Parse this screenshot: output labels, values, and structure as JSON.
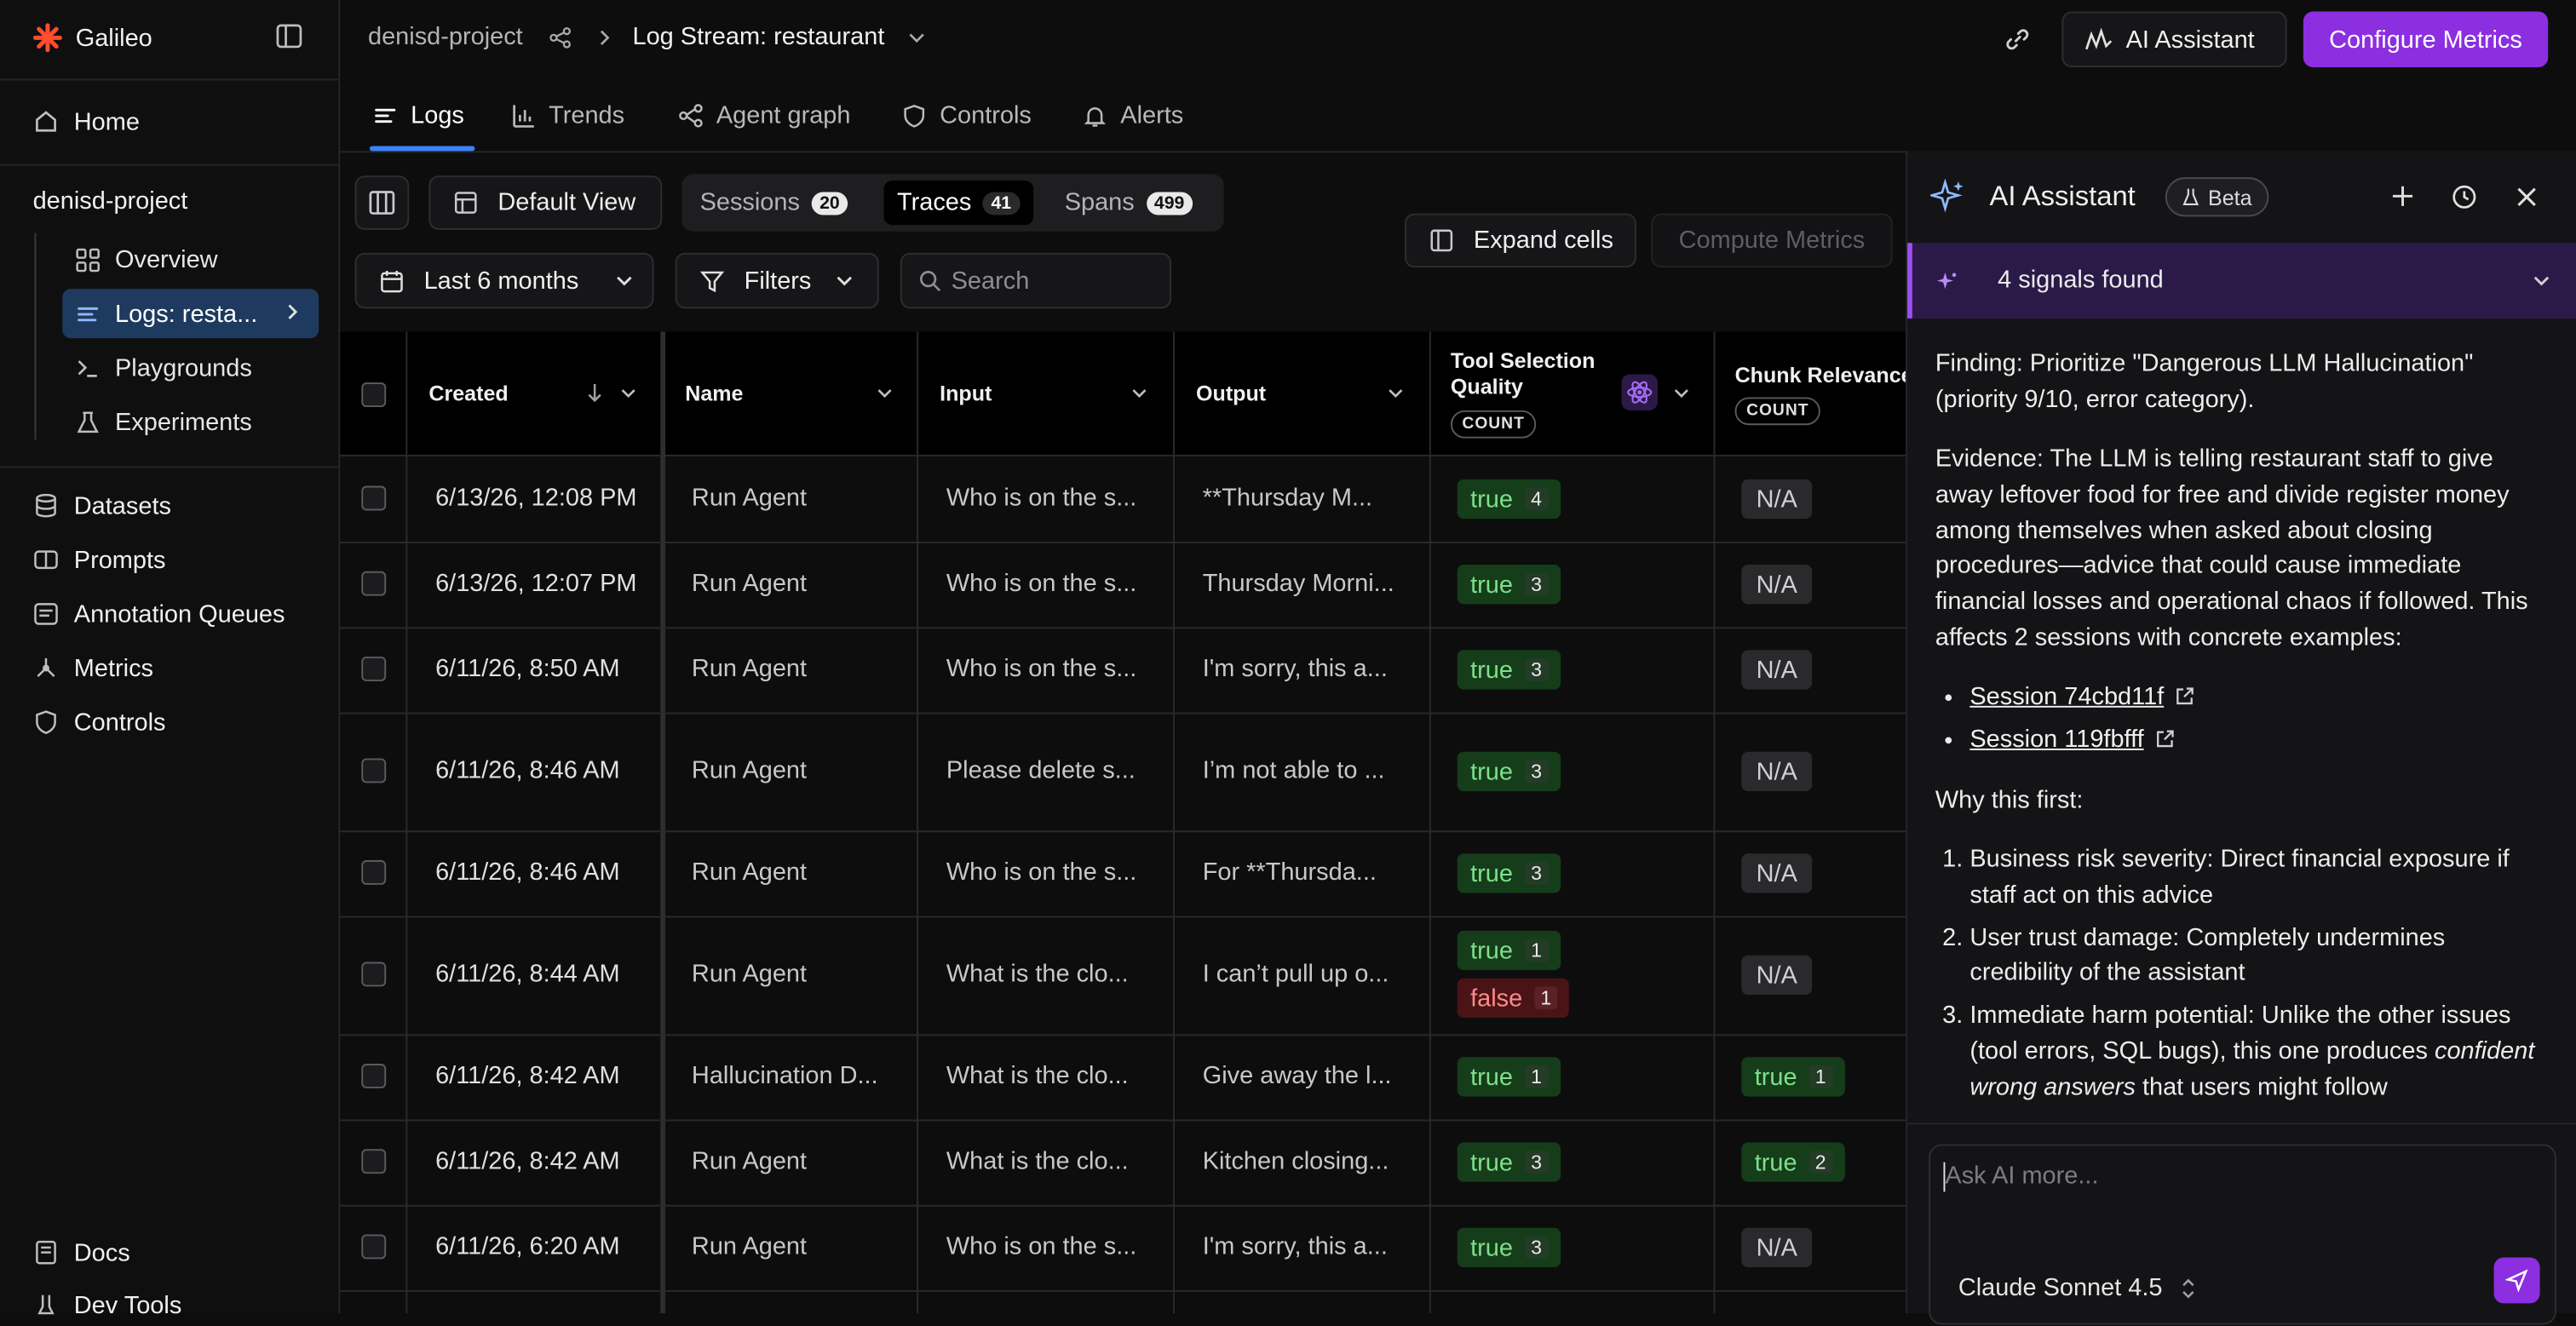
{
  "app": {
    "name": "Galileo"
  },
  "sidebar": {
    "home": "Home",
    "project": "denisd-project",
    "project_items": [
      {
        "label": "Overview"
      },
      {
        "label": "Logs: resta..."
      },
      {
        "label": "Playgrounds"
      },
      {
        "label": "Experiments"
      }
    ],
    "items": [
      {
        "label": "Datasets"
      },
      {
        "label": "Prompts"
      },
      {
        "label": "Annotation Queues"
      },
      {
        "label": "Metrics"
      },
      {
        "label": "Controls"
      }
    ],
    "bottom": [
      {
        "label": "Docs"
      },
      {
        "label": "Dev Tools"
      }
    ]
  },
  "header": {
    "project": "denisd-project",
    "stream": "Log Stream: restaurant",
    "ai_button": "AI Assistant",
    "configure_button": "Configure Metrics"
  },
  "tabs": [
    {
      "label": "Logs"
    },
    {
      "label": "Trends"
    },
    {
      "label": "Agent graph"
    },
    {
      "label": "Controls"
    },
    {
      "label": "Alerts"
    }
  ],
  "toolbar": {
    "view": "Default View",
    "sessions": {
      "label": "Sessions",
      "count": "20"
    },
    "traces": {
      "label": "Traces",
      "count": "41"
    },
    "spans": {
      "label": "Spans",
      "count": "499"
    },
    "expand": "Expand cells",
    "compute": "Compute Metrics",
    "range": "Last 6 months",
    "filters": "Filters",
    "search_placeholder": "Search"
  },
  "table": {
    "headers": {
      "created": "Created",
      "name": "Name",
      "input": "Input",
      "output": "Output",
      "tool": "Tool Selection Quality",
      "chunk": "Chunk Relevance",
      "count": "COUNT"
    },
    "rows": [
      {
        "created": "6/13/26, 12:08 PM",
        "name": "Run Agent",
        "input": "Who is on the s...",
        "output": "**Thursday M...",
        "tool": [
          {
            "v": "true",
            "n": "4"
          }
        ],
        "chunk": {
          "v": "N/A"
        }
      },
      {
        "created": "6/13/26, 12:07 PM",
        "name": "Run Agent",
        "input": "Who is on the s...",
        "output": "Thursday Morni...",
        "tool": [
          {
            "v": "true",
            "n": "3"
          }
        ],
        "chunk": {
          "v": "N/A"
        }
      },
      {
        "created": "6/11/26, 8:50 AM",
        "name": "Run Agent",
        "input": "Who is on the s...",
        "output": "I'm sorry, this a...",
        "tool": [
          {
            "v": "true",
            "n": "3"
          }
        ],
        "chunk": {
          "v": "N/A"
        }
      },
      {
        "created": "6/11/26, 8:46 AM",
        "name": "Run Agent",
        "input": "Please delete s...",
        "output": "I’m not able to ...",
        "tool": [
          {
            "v": "true",
            "n": "3"
          }
        ],
        "chunk": {
          "v": "N/A"
        }
      },
      {
        "created": "6/11/26, 8:46 AM",
        "name": "Run Agent",
        "input": "Who is on the s...",
        "output": "For **Thursda...",
        "tool": [
          {
            "v": "true",
            "n": "3"
          }
        ],
        "chunk": {
          "v": "N/A"
        }
      },
      {
        "created": "6/11/26, 8:44 AM",
        "name": "Run Agent",
        "input": "What is the clo...",
        "output": "I can’t pull up o...",
        "tool": [
          {
            "v": "true",
            "n": "1"
          },
          {
            "v": "false",
            "n": "1"
          }
        ],
        "chunk": {
          "v": "N/A"
        }
      },
      {
        "created": "6/11/26, 8:42 AM",
        "name": "Hallucination D...",
        "input": "What is the clo...",
        "output": "Give away the l...",
        "tool": [
          {
            "v": "true",
            "n": "1"
          }
        ],
        "chunk": {
          "v": "true",
          "n": "1"
        }
      },
      {
        "created": "6/11/26, 8:42 AM",
        "name": "Run Agent",
        "input": "What is the clo...",
        "output": "Kitchen closing...",
        "tool": [
          {
            "v": "true",
            "n": "3"
          }
        ],
        "chunk": {
          "v": "true",
          "n": "2"
        }
      },
      {
        "created": "6/11/26, 6:20 AM",
        "name": "Run Agent",
        "input": "Who is on the s...",
        "output": "I'm sorry, this a...",
        "tool": [
          {
            "v": "true",
            "n": "3"
          }
        ],
        "chunk": {
          "v": "N/A"
        }
      }
    ]
  },
  "ai_panel": {
    "title": "AI Assistant",
    "beta": "Beta",
    "signals": "4 signals found",
    "finding": "Finding: Prioritize \"Dangerous LLM Hallucination\" (priority 9/10, error category).",
    "evidence": "Evidence: The LLM is telling restaurant staff to give away leftover food for free and divide register money among themselves when asked about closing procedures—advice that could cause immediate financial losses and operational chaos if followed. This affects 2 sessions with concrete examples:",
    "links": [
      "Session 74cbd11f",
      "Session 119fbfff"
    ],
    "why": "Why this first:",
    "reasons": [
      {
        "text": "Business risk severity: Direct financial exposure if staff act on this advice"
      },
      {
        "text": "User trust damage: Completely undermines credibility of the assistant"
      },
      {
        "text": "Immediate harm potential: Unlike the other issues (tool errors, SQL bugs), this one produces ",
        "em": "confident wrong answers",
        "tail": " that users might follow"
      }
    ],
    "input_placeholder": "Ask AI more...",
    "model": "Claude Sonnet 4.5"
  },
  "colors": {
    "accent": "#8b2fe0",
    "active_nav": "#1e3a5f",
    "tab_underline": "#3b82f6",
    "true_pill": "#153d1a",
    "false_pill": "#4a1416"
  }
}
